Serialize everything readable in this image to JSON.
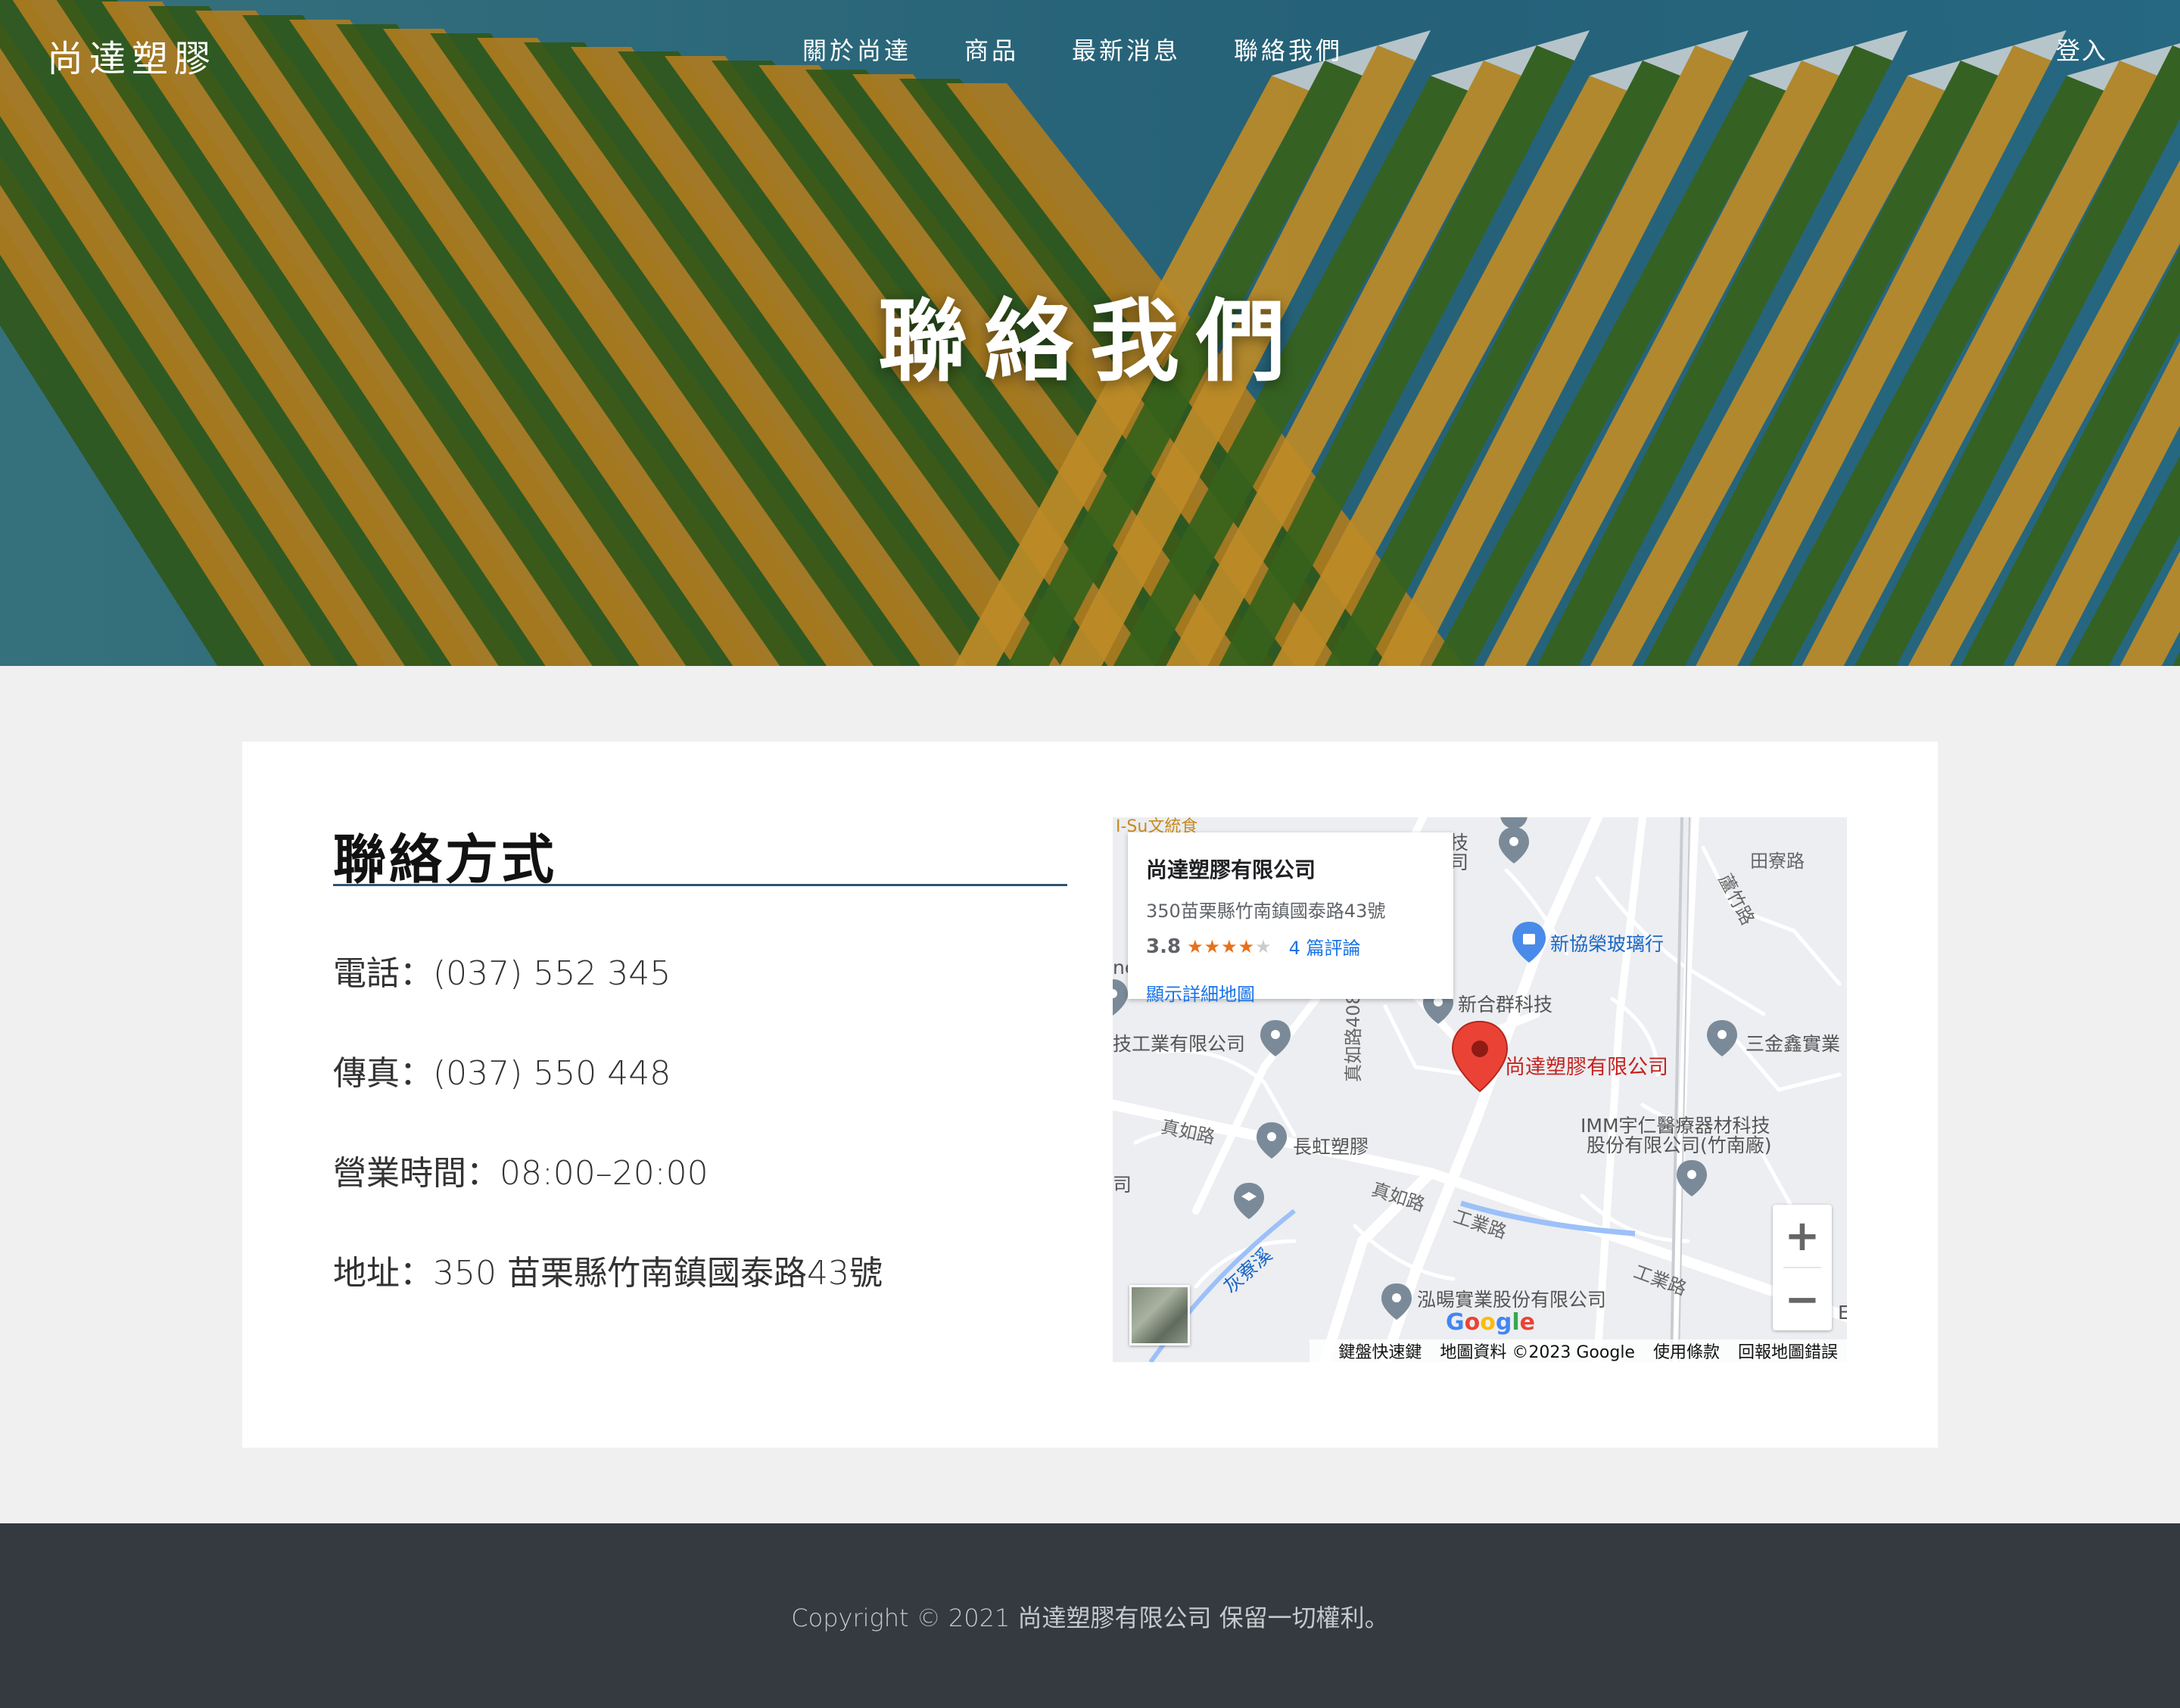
{
  "header": {
    "logo": "尚達塑膠",
    "nav": [
      "關於尚達",
      "商品",
      "最新消息",
      "聯絡我們"
    ],
    "login": "登入"
  },
  "hero": {
    "title": "聯絡我們"
  },
  "contact": {
    "heading": "聯絡方式",
    "phone": "電話：(037) 552 345",
    "fax": "傳真：(037) 550 448",
    "hours": "營業時間：08:00–20:00",
    "address": "地址：350 苗栗縣竹南鎮國泰路43號"
  },
  "map": {
    "info": {
      "title": "尚達塑膠有限公司",
      "address": "350苗栗縣竹南鎮國泰路43號",
      "rating": "3.8",
      "stars_filled": 4,
      "reviews": "4 篇評論",
      "details_link": "顯示詳細地圖"
    },
    "labels": {
      "xinxie": "新協榮玻璃行",
      "xinhequn": "新合群科技",
      "sanjinxin": "三金鑫實業",
      "target": "尚達塑膠有限公司",
      "imm1": "IMM宇仁醫療器材科技",
      "imm2": "股份有限公司(竹南廠)",
      "changhong": "長虹塑膠",
      "hongyang": "泓暘實業股份有限公司",
      "gongye_left": "技工業有限公司",
      "tech_top": "科技",
      "co_top": "公司",
      "huiliao": "灰寮溪",
      "zhenru_left": "真如路",
      "zhenru_mid": "真如路",
      "gongye_road1": "工業路",
      "gongye_road2": "工業路",
      "zhenru408": "真如路408巷",
      "tianliao": "田寮路",
      "luzhu": "蘆竹路",
      "top_cut": "I-Su文統食",
      "ne": "ne",
      "si": "司",
      "e_cut": "E"
    },
    "google": [
      "G",
      "o",
      "o",
      "g",
      "l",
      "e"
    ],
    "footer": [
      "鍵盤快速鍵",
      "地圖資料 ©2023 Google",
      "使用條款",
      "回報地圖錯誤"
    ],
    "zoom_in": "+",
    "zoom_out": "−"
  },
  "footer": {
    "copyright": "Copyright © 2021 尚達塑膠有限公司 保留一切權利。"
  },
  "colors": {
    "footer_bg": "#343a40",
    "heading_rule": "#2f5470",
    "link": "#1a73e8",
    "pin_red": "#ea4335"
  }
}
